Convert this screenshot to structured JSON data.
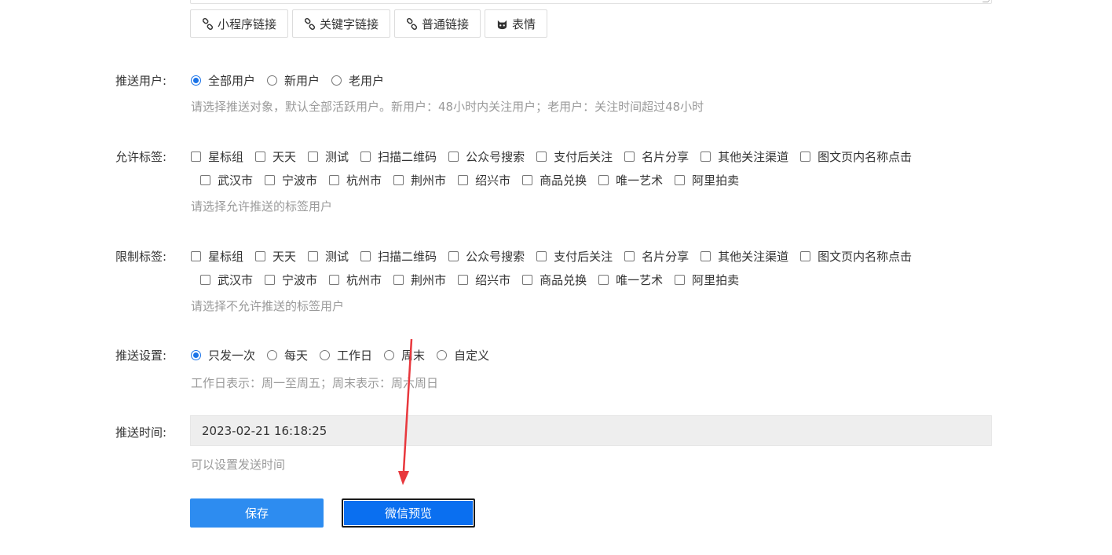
{
  "toolbar": {
    "miniprogram_link": "小程序链接",
    "keyword_link": "关键字链接",
    "normal_link": "普通链接",
    "emoji": "表情"
  },
  "push_users": {
    "label": "推送用户:",
    "options": [
      "全部用户",
      "新用户",
      "老用户"
    ],
    "selected": "全部用户",
    "hint": "请选择推送对象，默认全部活跃用户。新用户：48小时内关注用户；老用户：关注时间超过48小时"
  },
  "allow_tags": {
    "label": "允许标签:",
    "row1": [
      "星标组",
      "天天",
      "测试",
      "扫描二维码",
      "公众号搜索",
      "支付后关注",
      "名片分享",
      "其他关注渠道",
      "图文页内名称点击"
    ],
    "row2": [
      "武汉市",
      "宁波市",
      "杭州市",
      "荆州市",
      "绍兴市",
      "商品兑换",
      "唯一艺术",
      "阿里拍卖"
    ],
    "hint": "请选择允许推送的标签用户"
  },
  "restrict_tags": {
    "label": "限制标签:",
    "row1": [
      "星标组",
      "天天",
      "测试",
      "扫描二维码",
      "公众号搜索",
      "支付后关注",
      "名片分享",
      "其他关注渠道",
      "图文页内名称点击"
    ],
    "row2": [
      "武汉市",
      "宁波市",
      "杭州市",
      "荆州市",
      "绍兴市",
      "商品兑换",
      "唯一艺术",
      "阿里拍卖"
    ],
    "hint": "请选择不允许推送的标签用户"
  },
  "push_settings": {
    "label": "推送设置:",
    "options": [
      "只发一次",
      "每天",
      "工作日",
      "周末",
      "自定义"
    ],
    "selected": "只发一次",
    "hint": "工作日表示：周一至周五；周末表示：周六周日"
  },
  "push_time": {
    "label": "推送时间:",
    "value": "2023-02-21 16:18:25",
    "hint": "可以设置发送时间"
  },
  "actions": {
    "save": "保存",
    "wechat_preview": "微信预览"
  },
  "colors": {
    "primary": "#2d8cf0",
    "preview": "#0a6ff0",
    "annotation_arrow": "#e8383d"
  }
}
